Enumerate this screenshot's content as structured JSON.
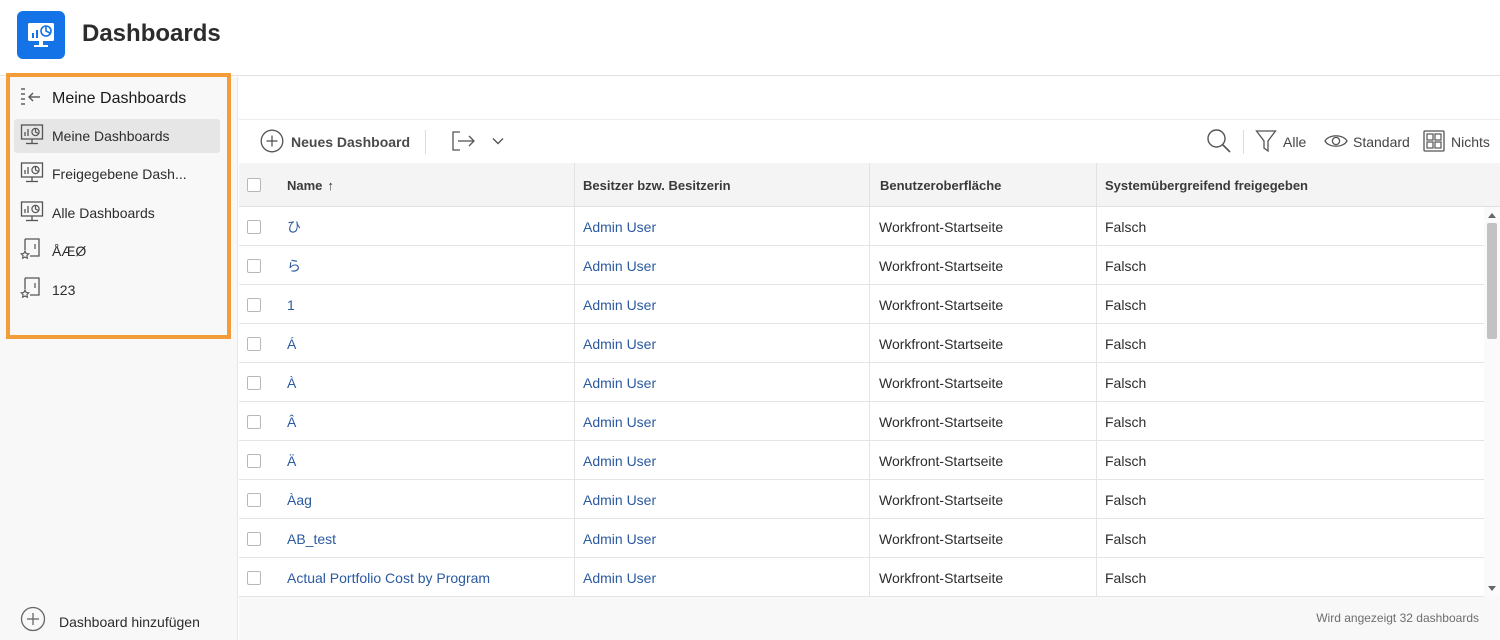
{
  "app": {
    "title": "Dashboards",
    "logo_icon": "dashboard-monitor-icon",
    "accent_color": "#1473e6"
  },
  "sidebar": {
    "heading": "Meine Dashboards",
    "collapse_icon": "collapse-panel-icon",
    "highlight_color": "#f39c3a",
    "items": [
      {
        "label": "Meine Dashboards",
        "icon": "dashboard-icon",
        "active": true
      },
      {
        "label": "Freigegebene Dash...",
        "icon": "dashboard-icon",
        "active": false
      },
      {
        "label": "Alle Dashboards",
        "icon": "dashboard-icon",
        "active": false
      },
      {
        "label": "ÅÆØ",
        "icon": "favorite-dashboard-icon",
        "active": false
      },
      {
        "label": "123",
        "icon": "favorite-dashboard-icon",
        "active": false
      }
    ],
    "add_label": "Dashboard hinzufügen"
  },
  "toolbar": {
    "new_dashboard": "Neues Dashboard",
    "filter_label": "Alle",
    "view_label": "Standard",
    "group_label": "Nichts"
  },
  "table": {
    "columns": [
      "Name",
      "Besitzer bzw. Besitzerin",
      "Benutzeroberfläche",
      "Systemübergreifend freigegeben"
    ],
    "sort_indicator": "↑",
    "rows": [
      {
        "name": "ひ",
        "owner": "Admin User",
        "ui": "Workfront-Startseite",
        "shared": "Falsch"
      },
      {
        "name": "ら",
        "owner": "Admin User",
        "ui": "Workfront-Startseite",
        "shared": "Falsch"
      },
      {
        "name": "1",
        "owner": "Admin User",
        "ui": "Workfront-Startseite",
        "shared": "Falsch"
      },
      {
        "name": "Á",
        "owner": "Admin User",
        "ui": "Workfront-Startseite",
        "shared": "Falsch"
      },
      {
        "name": "À",
        "owner": "Admin User",
        "ui": "Workfront-Startseite",
        "shared": "Falsch"
      },
      {
        "name": "Â",
        "owner": "Admin User",
        "ui": "Workfront-Startseite",
        "shared": "Falsch"
      },
      {
        "name": "Ä",
        "owner": "Admin User",
        "ui": "Workfront-Startseite",
        "shared": "Falsch"
      },
      {
        "name": "Àag",
        "owner": "Admin User",
        "ui": "Workfront-Startseite",
        "shared": "Falsch"
      },
      {
        "name": "AB_test",
        "owner": "Admin User",
        "ui": "Workfront-Startseite",
        "shared": "Falsch"
      },
      {
        "name": "Actual Portfolio Cost by Program",
        "owner": "Admin User",
        "ui": "Workfront-Startseite",
        "shared": "Falsch"
      }
    ]
  },
  "footer": {
    "count_text": "Wird angezeigt 32 dashboards"
  }
}
